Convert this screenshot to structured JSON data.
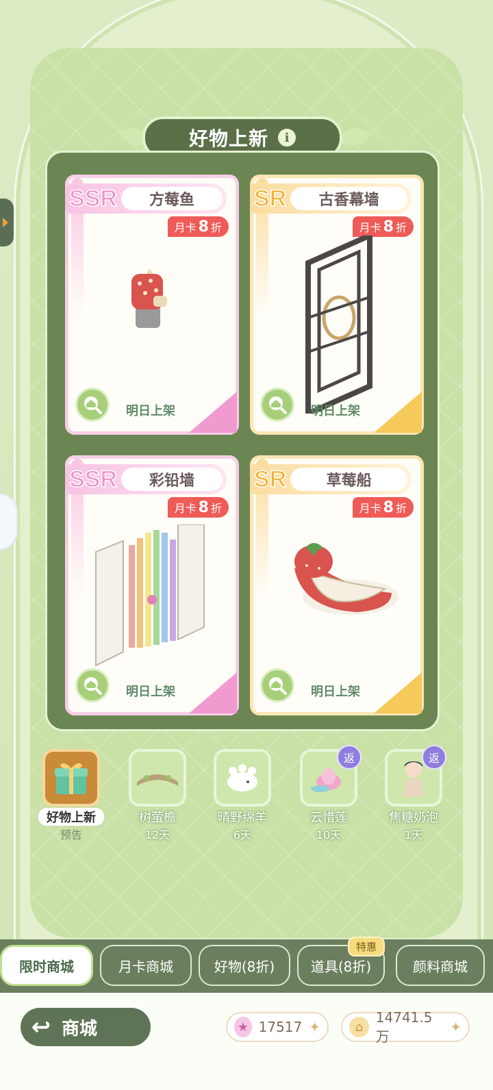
{
  "banner": {
    "title": "好物上新",
    "info_icon": "info-icon"
  },
  "cards": [
    {
      "rarity": "SSR",
      "name": "方莓鱼",
      "badge_prefix": "月卡",
      "badge_num": "8",
      "badge_suffix": "折",
      "status": "明日上架"
    },
    {
      "rarity": "SR",
      "name": "古香幕墙",
      "badge_prefix": "月卡",
      "badge_num": "8",
      "badge_suffix": "折",
      "status": "明日上架"
    },
    {
      "rarity": "SSR",
      "name": "彩铅墙",
      "badge_prefix": "月卡",
      "badge_num": "8",
      "badge_suffix": "折",
      "status": "明日上架"
    },
    {
      "rarity": "SR",
      "name": "草莓船",
      "badge_prefix": "月卡",
      "badge_num": "8",
      "badge_suffix": "折",
      "status": "明日上架"
    }
  ],
  "thumbs": [
    {
      "label": "好物上新",
      "sub": "预告",
      "badge": ""
    },
    {
      "label": "树萤檐",
      "sub": "12天",
      "badge": ""
    },
    {
      "label": "晴野绵羊",
      "sub": "6天",
      "badge": ""
    },
    {
      "label": "云惜莲",
      "sub": "10天",
      "badge": "返"
    },
    {
      "label": "焦糖奶泡",
      "sub": "1天",
      "badge": "返"
    }
  ],
  "tabs": [
    {
      "label": "限时商城",
      "active": true
    },
    {
      "label": "月卡商城"
    },
    {
      "label": "好物(8折)"
    },
    {
      "label": "道具(8折)",
      "tag": "特惠"
    },
    {
      "label": "颜料商城"
    }
  ],
  "bottom": {
    "back_label": "商城",
    "star_currency": "17517",
    "coin_currency": "14741.5万"
  },
  "colors": {
    "accent_green": "#6b8553",
    "pink": "#ee93c8",
    "gold": "#f2b234",
    "badge_red": "#ef5b57"
  }
}
